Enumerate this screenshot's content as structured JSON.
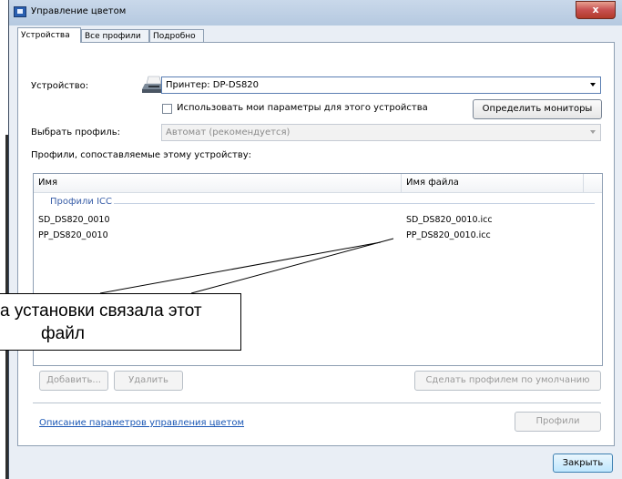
{
  "window": {
    "title": "Управление цветом",
    "close_glyph": "x"
  },
  "tabs": [
    {
      "label": "Устройства",
      "active": true
    },
    {
      "label": "Все профили",
      "active": false
    },
    {
      "label": "Подробно",
      "active": false
    }
  ],
  "device": {
    "label": "Устройство:",
    "value": "Принтер: DP-DS820",
    "icon": "printer-icon",
    "use_my_settings_label": "Использовать мои параметры для этого устройства",
    "use_my_settings_checked": false,
    "identify_monitors_label": "Определить мониторы"
  },
  "profile_select": {
    "label": "Выбрать профиль:",
    "value": "Автомат (рекомендуется)"
  },
  "associated_label": "Профили, сопоставляемые этому устройству:",
  "list": {
    "columns": [
      "Имя",
      "Имя файла"
    ],
    "group": "Профили ICC",
    "rows": [
      {
        "name": "SD_DS820_0010",
        "file": "SD_DS820_0010.icc"
      },
      {
        "name": "PP_DS820_0010",
        "file": "PP_DS820_0010.icc"
      }
    ]
  },
  "buttons": {
    "add": "Добавить...",
    "remove": "Удалить",
    "set_default": "Сделать профилем по умолчанию",
    "profiles": "Профили",
    "close": "Закрыть"
  },
  "help_link": "Описание параметров управления цветом",
  "callout": {
    "line1": "а установки связала этот",
    "line2": "файл"
  },
  "colors": {
    "link": "#1a57b5",
    "group_text": "#3a5fa8",
    "close_button": "#c75050"
  }
}
